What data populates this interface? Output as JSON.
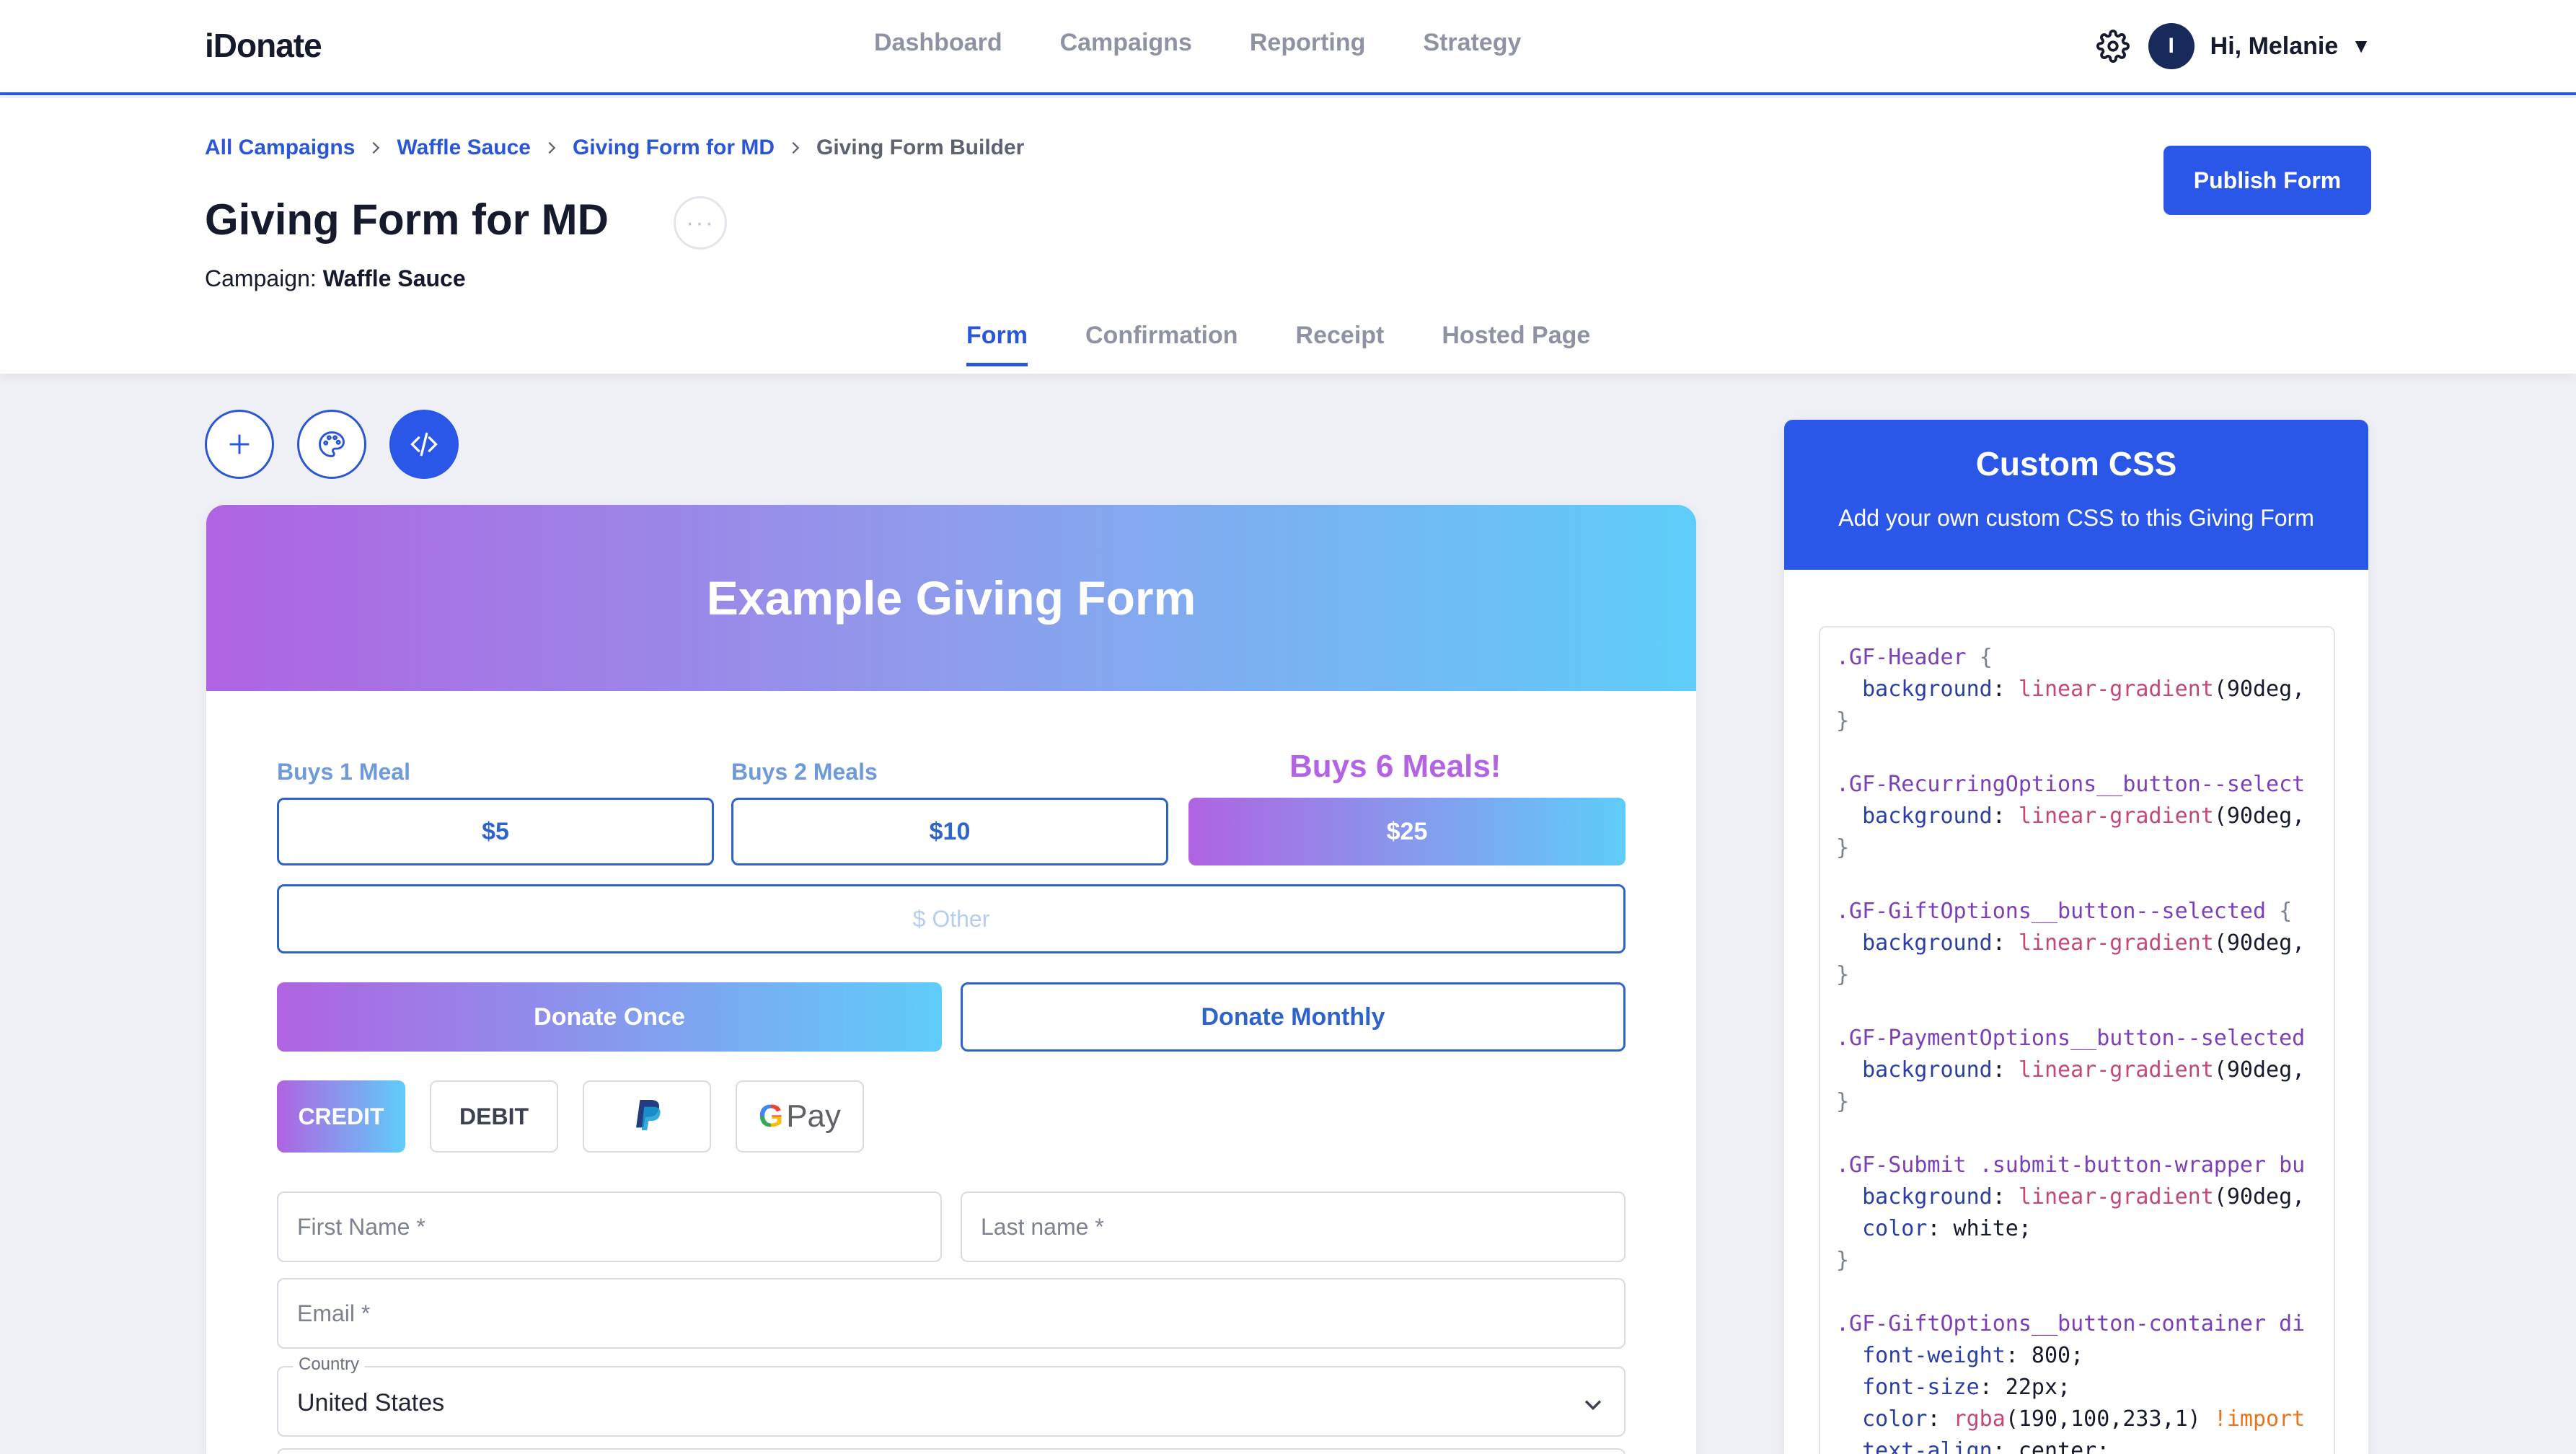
{
  "app": {
    "logo": "iDonate",
    "nav": [
      "Dashboard",
      "Campaigns",
      "Reporting",
      "Strategy"
    ],
    "user_initial": "I",
    "greeting": "Hi, Melanie",
    "caret": "▼"
  },
  "header": {
    "breadcrumb": [
      "All Campaigns",
      "Waffle Sauce",
      "Giving Form for MD",
      "Giving Form Builder"
    ],
    "title": "Giving Form for MD",
    "more": "···",
    "campaign_label": "Campaign:",
    "campaign_name": "Waffle Sauce",
    "publish_label": "Publish Form",
    "tabs": [
      "Form",
      "Confirmation",
      "Receipt",
      "Hosted Page"
    ],
    "active_tab": "Form"
  },
  "tools": [
    "add-icon",
    "palette-icon",
    "code-icon"
  ],
  "form": {
    "title": "Example Giving Form",
    "amounts": [
      {
        "label": "Buys 1 Meal",
        "value": "$5",
        "selected": false
      },
      {
        "label": "Buys 2 Meals",
        "value": "$10",
        "selected": false
      },
      {
        "label": "Buys 6 Meals!",
        "value": "$25",
        "selected": true
      }
    ],
    "other_placeholder": "$ Other",
    "frequency": [
      {
        "label": "Donate Once",
        "selected": true
      },
      {
        "label": "Donate Monthly",
        "selected": false
      }
    ],
    "payment": [
      {
        "label": "CREDIT",
        "selected": true
      },
      {
        "label": "DEBIT",
        "selected": false
      },
      {
        "label": "paypal-icon",
        "selected": false
      },
      {
        "label": "Pay",
        "selected": false
      }
    ],
    "gpay_g": "G",
    "first_name_placeholder": "First Name *",
    "last_name_placeholder": "Last name *",
    "email_placeholder": "Email *",
    "country_label": "Country",
    "country_value": "United States"
  },
  "css_panel": {
    "title": "Custom CSS",
    "subtitle": "Add your own custom CSS to this Giving Form",
    "code": [
      [
        {
          "t": ".GF-Header ",
          "c": "sel"
        },
        {
          "t": "{",
          "c": "punct"
        }
      ],
      [
        {
          "t": "  background",
          "c": "prop"
        },
        {
          "t": ": ",
          "c": "val"
        },
        {
          "t": "linear-gradient",
          "c": "fn"
        },
        {
          "t": "(90deg,",
          "c": "val"
        }
      ],
      [
        {
          "t": "}",
          "c": "punct"
        }
      ],
      [],
      [
        {
          "t": ".GF-RecurringOptions__button--select",
          "c": "sel"
        }
      ],
      [
        {
          "t": "  background",
          "c": "prop"
        },
        {
          "t": ": ",
          "c": "val"
        },
        {
          "t": "linear-gradient",
          "c": "fn"
        },
        {
          "t": "(90deg,",
          "c": "val"
        }
      ],
      [
        {
          "t": "}",
          "c": "punct"
        }
      ],
      [],
      [
        {
          "t": ".GF-GiftOptions__button--selected ",
          "c": "sel"
        },
        {
          "t": "{",
          "c": "punct"
        }
      ],
      [
        {
          "t": "  background",
          "c": "prop"
        },
        {
          "t": ": ",
          "c": "val"
        },
        {
          "t": "linear-gradient",
          "c": "fn"
        },
        {
          "t": "(90deg,",
          "c": "val"
        }
      ],
      [
        {
          "t": "}",
          "c": "punct"
        }
      ],
      [],
      [
        {
          "t": ".GF-PaymentOptions__button--selected",
          "c": "sel"
        }
      ],
      [
        {
          "t": "  background",
          "c": "prop"
        },
        {
          "t": ": ",
          "c": "val"
        },
        {
          "t": "linear-gradient",
          "c": "fn"
        },
        {
          "t": "(90deg,",
          "c": "val"
        }
      ],
      [
        {
          "t": "}",
          "c": "punct"
        }
      ],
      [],
      [
        {
          "t": ".GF-Submit .submit-button-wrapper bu",
          "c": "sel"
        }
      ],
      [
        {
          "t": "  background",
          "c": "prop"
        },
        {
          "t": ": ",
          "c": "val"
        },
        {
          "t": "linear-gradient",
          "c": "fn"
        },
        {
          "t": "(90deg,",
          "c": "val"
        }
      ],
      [
        {
          "t": "  color",
          "c": "prop"
        },
        {
          "t": ": white;",
          "c": "val"
        }
      ],
      [
        {
          "t": "}",
          "c": "punct"
        }
      ],
      [],
      [
        {
          "t": ".GF-GiftOptions__button-container di",
          "c": "sel"
        }
      ],
      [
        {
          "t": "  font-weight",
          "c": "prop"
        },
        {
          "t": ": 800;",
          "c": "val"
        }
      ],
      [
        {
          "t": "  font-size",
          "c": "prop"
        },
        {
          "t": ": 22px;",
          "c": "val"
        }
      ],
      [
        {
          "t": "  color",
          "c": "prop"
        },
        {
          "t": ": ",
          "c": "val"
        },
        {
          "t": "rgba",
          "c": "fn"
        },
        {
          "t": "(190,100,233,1) ",
          "c": "val"
        },
        {
          "t": "!import",
          "c": "imp"
        }
      ],
      [
        {
          "t": "  text-align",
          "c": "prop"
        },
        {
          "t": ": center;",
          "c": "val"
        }
      ]
    ]
  },
  "colors": {
    "brand": "#2b57e8",
    "gradient_start": "#b063e2",
    "gradient_end": "#5fcdf9",
    "outline_blue": "#2f63cc"
  }
}
